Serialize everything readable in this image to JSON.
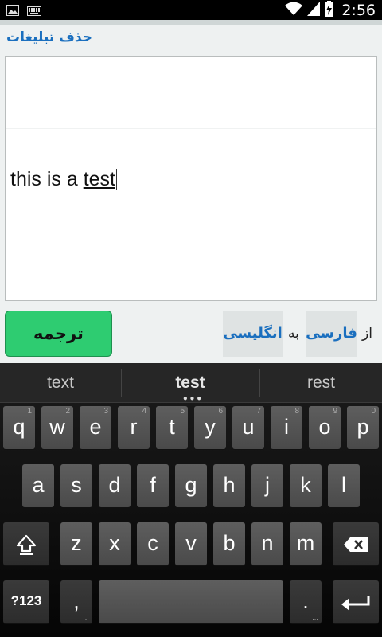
{
  "status_bar": {
    "time": "2:56",
    "icons": [
      "image-notification-icon",
      "keyboard-notification-icon",
      "wifi-icon",
      "signal-icon",
      "battery-charging-icon"
    ]
  },
  "app": {
    "remove_ads": "حذف تبلیغات",
    "input_text_plain": "this is a ",
    "input_text_composing": "test",
    "translate_button": "ترجمه",
    "from_word": "از",
    "from_language": "فارسی",
    "to_word": "به",
    "to_language": "انگلیسی"
  },
  "keyboard": {
    "suggestions": [
      "text",
      "test",
      "rest"
    ],
    "row1": [
      {
        "label": "q",
        "hint": "1"
      },
      {
        "label": "w",
        "hint": "2"
      },
      {
        "label": "e",
        "hint": "3"
      },
      {
        "label": "r",
        "hint": "4"
      },
      {
        "label": "t",
        "hint": "5"
      },
      {
        "label": "y",
        "hint": "6"
      },
      {
        "label": "u",
        "hint": "7"
      },
      {
        "label": "i",
        "hint": "8"
      },
      {
        "label": "o",
        "hint": "9"
      },
      {
        "label": "p",
        "hint": "0"
      }
    ],
    "row2": [
      "a",
      "s",
      "d",
      "f",
      "g",
      "h",
      "j",
      "k",
      "l"
    ],
    "row3": [
      "z",
      "x",
      "c",
      "v",
      "b",
      "n",
      "m"
    ],
    "symbols_key": "?123",
    "comma_key": ",",
    "period_key": ".",
    "more_mark": "…"
  },
  "colors": {
    "accent_blue": "#1a6fbf",
    "translate_green": "#2ecc71"
  }
}
